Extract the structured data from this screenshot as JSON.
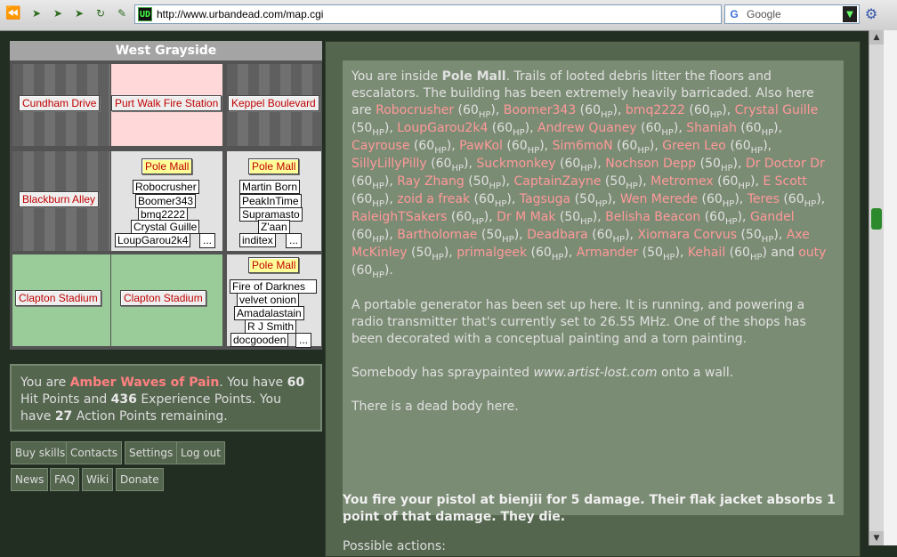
{
  "browser": {
    "url": "http://www.urbandead.com/map.cgi",
    "site_icon": "UD",
    "search_placeholder": "Google",
    "icons": [
      "back-icon",
      "forward-icon",
      "reload-icon",
      "stop-icon",
      "home-icon",
      "site-icon",
      "help-icon",
      "go-icon",
      "google-icon",
      "gear-icon"
    ]
  },
  "map": {
    "title": "West Grayside",
    "cells": [
      {
        "name": "Cundham Drive"
      },
      {
        "name": "Purt Walk Fire Station"
      },
      {
        "name": "Keppel Boulevard"
      },
      {
        "name": "Blackburn Alley"
      },
      {
        "name": "Pole Mall",
        "names": [
          "Robocrusher",
          "Boomer343",
          "bmq2222",
          "Crystal Guille",
          "LoupGarou2k4"
        ],
        "more": "..."
      },
      {
        "name": "Pole Mall",
        "names": [
          "Martin Born",
          "PeakInTime",
          "Supramasto",
          "Z'aan",
          "inditex"
        ],
        "more": "..."
      },
      {
        "name": "Clapton Stadium"
      },
      {
        "name": "Clapton Stadium"
      },
      {
        "name": "Pole Mall",
        "names": [
          "Fire of Darknes",
          "velvet onion",
          "Amadalastain",
          "R J Smith",
          "docgooden"
        ],
        "more": "..."
      }
    ]
  },
  "status": {
    "p1": "You are ",
    "player": "Amber Waves of Pain",
    "p2": ". You have ",
    "hp": "60",
    "p3": " Hit Points and ",
    "xp": "436",
    "p4": " Experience Points. You have ",
    "ap": "27",
    "p5": " Action Points remaining."
  },
  "menu": {
    "row1": [
      "Buy skills",
      "Contacts",
      "Settings",
      "Log out"
    ],
    "row2": [
      "News",
      "FAQ",
      "Wiki",
      "Donate"
    ]
  },
  "description": {
    "intro": "You are inside ",
    "building": "Pole Mall",
    "intro_rest": ". Trails of looted debris litter the floors and escalators. The building has been extremely heavily barricaded. Also here are ",
    "hp_unit": "HP",
    "survivors": [
      {
        "name": "Robocrusher",
        "hp": "60"
      },
      {
        "name": "Boomer343",
        "hp": "60"
      },
      {
        "name": "bmq2222",
        "hp": "60"
      },
      {
        "name": "Crystal Guille",
        "hp": "50"
      },
      {
        "name": "LoupGarou2k4",
        "hp": "60"
      },
      {
        "name": "Andrew Quaney",
        "hp": "60"
      },
      {
        "name": "Shaniah",
        "hp": "60"
      },
      {
        "name": "Cayrouse",
        "hp": "60"
      },
      {
        "name": "PawKol",
        "hp": "60"
      },
      {
        "name": "Sim6moN",
        "hp": "60"
      },
      {
        "name": "Green Leo",
        "hp": "60"
      },
      {
        "name": "SillyLillyPilly",
        "hp": "60"
      },
      {
        "name": "Suckmonkey",
        "hp": "60"
      },
      {
        "name": "Nochson Depp",
        "hp": "50"
      },
      {
        "name": "Dr Doctor Dr",
        "hp": "60"
      },
      {
        "name": "Ray Zhang",
        "hp": "50"
      },
      {
        "name": "CaptainZayne",
        "hp": "50"
      },
      {
        "name": "Metromex",
        "hp": "60"
      },
      {
        "name": "E Scott",
        "hp": "60"
      },
      {
        "name": "zoid a freak",
        "hp": "60"
      },
      {
        "name": "Tagsuga",
        "hp": "50"
      },
      {
        "name": "Wen Merede",
        "hp": "60"
      },
      {
        "name": "Teres",
        "hp": "60"
      },
      {
        "name": "RaleighTSakers",
        "hp": "60"
      },
      {
        "name": "Dr M Mak",
        "hp": "50"
      },
      {
        "name": "Belisha Beacon",
        "hp": "60"
      },
      {
        "name": "Gandel",
        "hp": "60"
      },
      {
        "name": "Bartholomae",
        "hp": "50"
      },
      {
        "name": "Deadbara",
        "hp": "60"
      },
      {
        "name": "Xiomara Corvus",
        "hp": "50"
      },
      {
        "name": "Axe McKinley",
        "hp": "50"
      },
      {
        "name": "primalgeek",
        "hp": "60"
      },
      {
        "name": "Armander",
        "hp": "50"
      },
      {
        "name": "Kehail",
        "hp": "60"
      },
      {
        "name": "outy",
        "hp": "60"
      }
    ],
    "generator": "A portable generator has been set up here. It is running, and powering a radio transmitter that's currently set to 26.55 MHz. One of the shops has been decorated with a conceptual painting and a torn painting.",
    "spray_pre": "Somebody has spraypainted ",
    "spray_text": "www.artist-lost.com",
    "spray_post": " onto a wall.",
    "body": "There is a dead body here."
  },
  "attack_message": "You fire your pistol at bienjii for 5 damage. Their flak jacket absorbs 1 point of that damage. They die.",
  "possible_actions_partial": "Possible actions:"
}
